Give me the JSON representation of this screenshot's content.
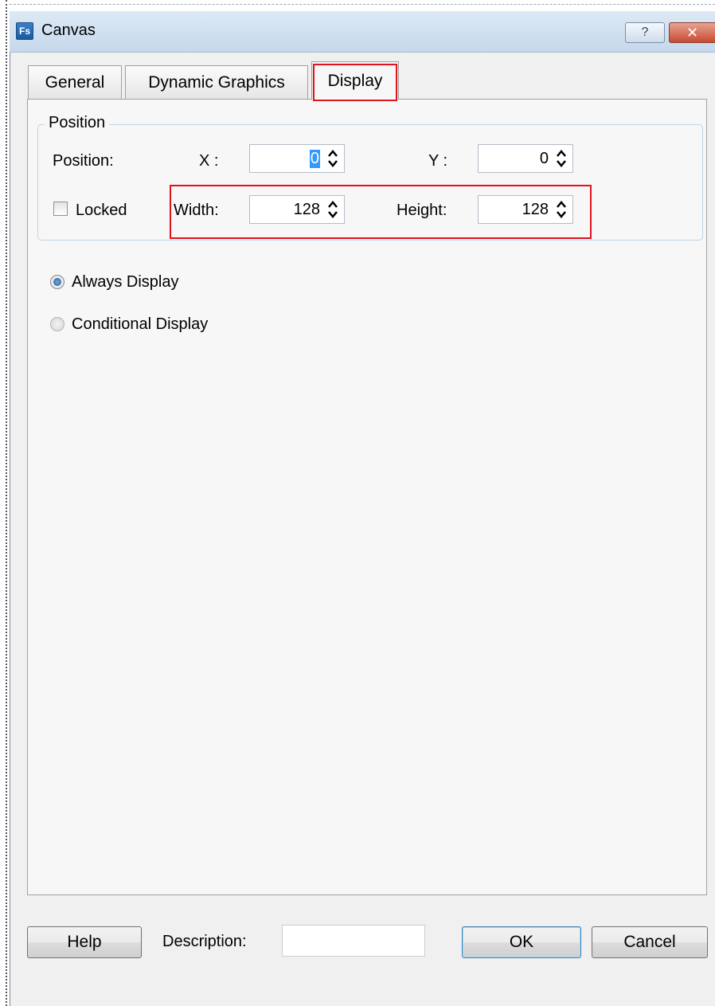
{
  "window": {
    "title": "Canvas",
    "app_icon_text": "Fs",
    "help_caption": "?",
    "close_caption": "✕"
  },
  "tabs": [
    {
      "label": "General",
      "active": false
    },
    {
      "label": "Dynamic Graphics",
      "active": false
    },
    {
      "label": "Display",
      "active": true
    }
  ],
  "position_group": {
    "title": "Position",
    "position_label": "Position:",
    "x_label": "X :",
    "x_value": "0",
    "y_label": "Y :",
    "y_value": "0",
    "locked_label": "Locked",
    "locked_checked": false,
    "width_label": "Width:",
    "width_value": "128",
    "height_label": "Height:",
    "height_value": "128"
  },
  "display_mode": {
    "always": {
      "label": "Always Display",
      "selected": true
    },
    "conditional": {
      "label": "Conditional Display",
      "selected": false
    }
  },
  "footer": {
    "help_label": "Help",
    "description_label": "Description:",
    "description_value": "",
    "ok_label": "OK",
    "cancel_label": "Cancel"
  },
  "colors": {
    "highlight_border": "#e0121b",
    "selection": "#3399ff"
  }
}
